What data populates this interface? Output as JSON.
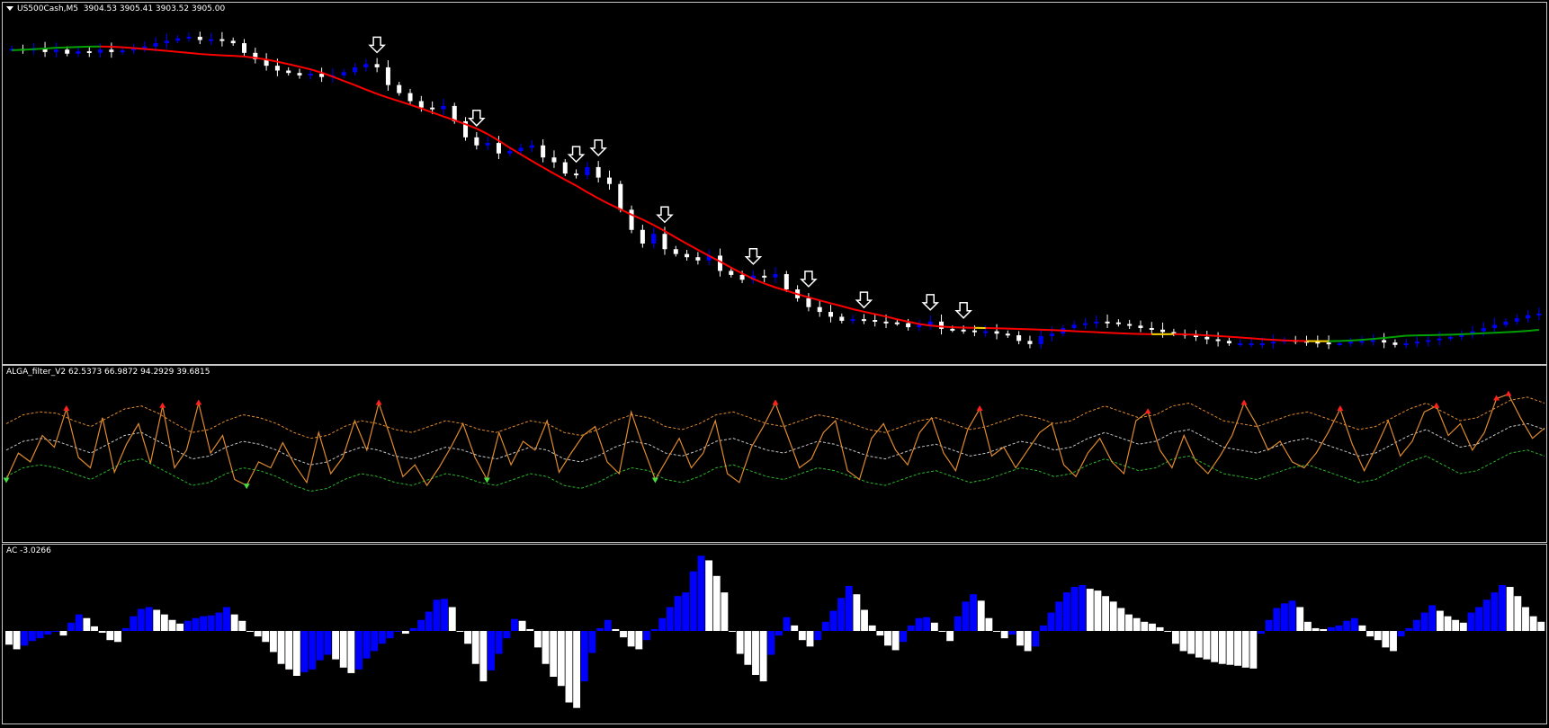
{
  "main_pane": {
    "symbol_label": "US500Cash,M5",
    "ohlc_label": "3904.53 3905.41 3903.52 3905.00"
  },
  "filter_pane": {
    "label": "ALGA_filter_V2 62.5373 66.9872 94.2929 39.6815"
  },
  "ac_pane": {
    "label": "AC -3.0266"
  },
  "colors": {
    "background": "#000000",
    "bull_candle": "#0000ff",
    "bear_candle": "#ffffff",
    "ma_down": "#ff0000",
    "ma_up": "#00a000",
    "ma_flat": "#ffd400",
    "filter_line": "#e08a2e",
    "upper_band": "#e08a2e",
    "middle_band": "#c8c8c8",
    "lower_band": "#2ab52a",
    "sell_marker": "#ff2020",
    "buy_marker": "#44dd44",
    "ac_up": "#0000ff",
    "ac_down": "#ffffff",
    "pane_border": "#c8c8c8"
  },
  "chart_data": [
    {
      "type": "candlestick",
      "title": "US500Cash,M5",
      "series": [
        {
          "name": "price",
          "values": [
            3908.5,
            3908.3,
            3908.6,
            3908.1,
            3908.4,
            3907.9,
            3908.2,
            3908,
            3908.4,
            3908.1,
            3908.3,
            3908.6,
            3908.8,
            3909.2,
            3909.5,
            3909.8,
            3910,
            3909.6,
            3909.7,
            3909.5,
            3909.2,
            3908,
            3907.2,
            3906.4,
            3905.8,
            3905.5,
            3905.2,
            3905.4,
            3905,
            3905.2,
            3905.6,
            3906.2,
            3906.6,
            3906.2,
            3904,
            3903,
            3902,
            3901.2,
            3901,
            3901.4,
            3899.5,
            3897.5,
            3896.5,
            3896.8,
            3895.5,
            3895.8,
            3896.2,
            3896.5,
            3895,
            3894.4,
            3893,
            3892.8,
            3893.8,
            3892.5,
            3891.7,
            3888.5,
            3886,
            3884.3,
            3885.5,
            3883.6,
            3883,
            3882.6,
            3882.2,
            3882.8,
            3880.9,
            3880.4,
            3879.8,
            3880.3,
            3880.1,
            3880.5,
            3878.6,
            3877.5,
            3876.4,
            3875.8,
            3875.2,
            3874.7,
            3874.9,
            3874.8,
            3874.6,
            3874.5,
            3874.4,
            3873.9,
            3874.2,
            3874.6,
            3873.7,
            3873.6,
            3873.5,
            3873.3,
            3873.4,
            3873.1,
            3872.9,
            3872.2,
            3871.8,
            3872.8,
            3873.1,
            3873.8,
            3874.2,
            3874.4,
            3874.6,
            3874.5,
            3874.3,
            3874.1,
            3873.8,
            3873.6,
            3873.3,
            3873.1,
            3872.9,
            3872.7,
            3872.4,
            3872.2,
            3871.9,
            3871.9,
            3871.9,
            3871.9,
            3872.1,
            3872.3,
            3872.2,
            3872.1,
            3872,
            3871.9,
            3871.9,
            3872.1,
            3872.2,
            3872.3,
            3872,
            3871.7,
            3871.9,
            3872.1,
            3872.3,
            3872.5,
            3872.7,
            3873,
            3873.4,
            3873.8,
            3874.2,
            3874.6,
            3875,
            3875.4,
            3875.6
          ]
        }
      ]
    },
    {
      "type": "line",
      "title": "ALGA_filter_V2",
      "series": [
        {
          "name": "62.5373",
          "values": [
            40,
            58,
            52,
            70,
            62,
            88,
            55,
            48,
            82,
            45,
            64,
            78,
            51,
            90,
            48,
            60,
            92,
            58,
            70,
            40,
            36,
            52,
            48,
            65,
            50,
            38,
            72,
            44,
            55,
            80,
            60,
            92,
            68,
            42,
            50,
            36,
            48,
            62,
            78,
            55,
            40,
            72,
            50,
            66,
            60,
            80,
            45,
            58,
            70,
            76,
            52,
            44,
            86,
            62,
            40,
            54,
            68,
            48,
            58,
            80,
            44,
            38,
            62,
            76,
            92,
            70,
            48,
            54,
            72,
            80,
            46,
            40,
            68,
            78,
            60,
            50,
            72,
            82,
            58,
            46,
            74,
            88,
            56,
            62,
            48,
            60,
            72,
            78,
            50,
            42,
            58,
            68,
            52,
            44,
            80,
            86,
            60,
            48,
            70,
            52,
            44,
            56,
            70,
            92,
            78,
            60,
            66,
            52,
            48,
            58,
            72,
            88,
            64,
            46,
            62,
            80,
            56,
            66,
            86,
            90,
            70,
            78,
            60,
            72,
            95,
            98,
            82,
            68,
            75
          ]
        },
        {
          "name": "66.9872",
          "values": [
            78,
            84,
            86,
            85,
            80,
            76,
            82,
            88,
            90,
            85,
            78,
            72,
            74,
            80,
            84,
            82,
            78,
            72,
            68,
            70,
            76,
            80,
            78,
            74,
            72,
            76,
            80,
            78,
            74,
            72,
            76,
            80,
            78,
            72,
            70,
            74,
            80,
            84,
            82,
            76,
            74,
            78,
            84,
            86,
            82,
            78,
            76,
            80,
            84,
            82,
            78,
            74,
            72,
            76,
            80,
            82,
            78,
            74,
            76,
            80,
            84,
            82,
            78,
            80,
            86,
            90,
            86,
            82,
            84,
            90,
            92,
            86,
            80,
            78,
            76,
            80,
            84,
            86,
            82,
            78,
            74,
            76,
            82,
            88,
            92,
            86,
            80,
            82,
            88,
            94,
            96,
            92
          ]
        },
        {
          "name": "94.2929",
          "values": [
            60,
            66,
            68,
            66,
            62,
            58,
            64,
            70,
            72,
            66,
            60,
            54,
            56,
            62,
            66,
            64,
            60,
            54,
            50,
            52,
            58,
            62,
            60,
            56,
            54,
            58,
            62,
            60,
            56,
            54,
            58,
            62,
            60,
            54,
            52,
            56,
            62,
            66,
            64,
            58,
            56,
            60,
            66,
            68,
            64,
            60,
            58,
            62,
            66,
            64,
            60,
            56,
            54,
            58,
            62,
            64,
            60,
            56,
            58,
            62,
            66,
            64,
            60,
            62,
            68,
            72,
            68,
            64,
            66,
            72,
            74,
            68,
            62,
            60,
            58,
            62,
            66,
            68,
            64,
            60,
            56,
            58,
            64,
            70,
            74,
            68,
            62,
            64,
            70,
            76,
            78,
            74
          ]
        },
        {
          "name": "39.6815",
          "values": [
            42,
            48,
            50,
            48,
            44,
            40,
            46,
            52,
            54,
            48,
            42,
            36,
            38,
            44,
            48,
            46,
            42,
            36,
            32,
            34,
            40,
            44,
            42,
            38,
            36,
            40,
            44,
            42,
            38,
            36,
            40,
            44,
            42,
            36,
            34,
            38,
            44,
            48,
            46,
            40,
            38,
            42,
            48,
            50,
            46,
            42,
            40,
            44,
            48,
            46,
            42,
            38,
            36,
            40,
            44,
            46,
            42,
            38,
            40,
            44,
            48,
            46,
            42,
            44,
            50,
            54,
            50,
            46,
            48,
            54,
            56,
            50,
            44,
            42,
            40,
            44,
            48,
            50,
            46,
            42,
            38,
            40,
            46,
            52,
            56,
            50,
            44,
            46,
            52,
            58,
            60,
            56
          ]
        }
      ]
    },
    {
      "type": "bar",
      "title": "AC",
      "series": [
        {
          "name": "AC",
          "values": [
            -1.5,
            -2,
            -1.6,
            -1.1,
            -0.8,
            -0.4,
            -0.1,
            -0.5,
            0.9,
            1.8,
            1.4,
            0.5,
            -0.2,
            -1,
            -1.2,
            0.3,
            1.6,
            2.4,
            2.6,
            2.3,
            1.8,
            1.2,
            0.8,
            1.1,
            1.4,
            1.6,
            1.7,
            2,
            2.6,
            1.8,
            1.1,
            0,
            -0.6,
            -1.2,
            -2.3,
            -3.6,
            -4.2,
            -4.9,
            -4.5,
            -4.2,
            -3.2,
            -2.6,
            -3.1,
            -4,
            -4.6,
            -4.2,
            -3,
            -2.2,
            -1.4,
            -0.8,
            0,
            -0.3,
            0.3,
            1.2,
            2.1,
            3.4,
            3.5,
            2.6,
            0,
            -1.4,
            -3.6,
            -5.5,
            -4.3,
            -2.5,
            -0.8,
            1.3,
            1.1,
            0.2,
            -1.8,
            -3.6,
            -5,
            -6,
            -7.8,
            -8.4,
            -5.5,
            -2.4,
            0.3,
            1.2,
            0.2,
            -0.7,
            -1.7,
            -2,
            -1,
            0.2,
            1.4,
            2.6,
            3.8,
            4.2,
            6.5,
            8.2,
            7.7,
            6,
            4.2,
            0,
            -2.5,
            -3.7,
            -4.8,
            -5.5,
            -2.6,
            -0.5,
            1.5,
            0.6,
            -1,
            -1.7,
            -1,
            1,
            2.2,
            3.6,
            4.9,
            4,
            2.3,
            0.6,
            -0.5,
            -1.6,
            -2.1,
            -1.2,
            0.6,
            1.4,
            1.5,
            0.9,
            0,
            -1.1,
            1.6,
            3.2,
            4,
            3.3,
            1.4,
            0,
            -0.8,
            -0.4,
            -1.6,
            -2.2,
            -1.7,
            0.6,
            2,
            3.2,
            4.2,
            4.8,
            5,
            4.6,
            4.4,
            3.8,
            3.2,
            2.5,
            1.8,
            1.4,
            1,
            0.8,
            0.4,
            0,
            -1.4,
            -2.2,
            -2.5,
            -2.9,
            -3.1,
            -3.4,
            -3.6,
            -3.7,
            -3.8,
            -4,
            -4.1,
            -0.3,
            1.2,
            2.5,
            3,
            3.3,
            2.6,
            1,
            0.3,
            0.2,
            0.4,
            0.6,
            1.1,
            1.4,
            0.6,
            -0.6,
            -1,
            -1.8,
            -2.2,
            -0.6,
            0.3,
            1.2,
            2,
            2.8,
            2.2,
            1.6,
            1.2,
            0.9,
            2,
            2.6,
            3.4,
            4.2,
            5,
            4.8,
            3.8,
            2.6,
            1.6,
            1
          ]
        }
      ]
    }
  ]
}
